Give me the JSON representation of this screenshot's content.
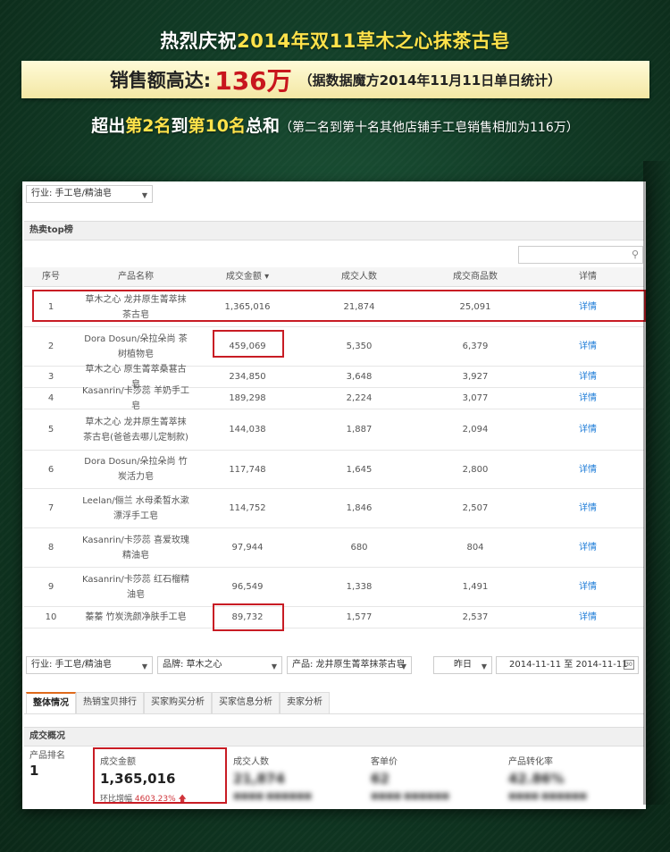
{
  "banner": {
    "line1_a": "热烈庆祝",
    "line1_b": "2014年双11草木之心",
    "line1_c": "抹茶古皂",
    "sales_label": "销售额高达:",
    "sales_amount": "136万",
    "sales_note": "（据数据魔方2014年11月11日单日统计）",
    "line3_a": "超出",
    "line3_b": "第2名",
    "line3_c": "到",
    "line3_d": "第10名",
    "line3_e": "总和",
    "line3_note": "（第二名到第十名其他店铺手工皂销售相加为116万）"
  },
  "filters_top": {
    "industry": "行业: 手工皂/精油皂"
  },
  "hot_section": {
    "title": "热卖top榜"
  },
  "table": {
    "headers": [
      "序号",
      "产品名称",
      "成交金额",
      "成交人数",
      "成交商品数",
      "详情"
    ],
    "rows": [
      {
        "rank": "1",
        "name": "草木之心 龙井原生菁萃抹茶古皂",
        "amount": "1,365,016",
        "buyers": "21,874",
        "items": "25,091",
        "detail": "详情"
      },
      {
        "rank": "2",
        "name": "Dora Dosun/朵拉朵尚 茶树植物皂",
        "amount": "459,069",
        "buyers": "5,350",
        "items": "6,379",
        "detail": "详情"
      },
      {
        "rank": "3",
        "name": "草木之心 原生菁萃桑葚古皂",
        "amount": "234,850",
        "buyers": "3,648",
        "items": "3,927",
        "detail": "详情"
      },
      {
        "rank": "4",
        "name": "Kasanrin/卡莎蕊 羊奶手工皂",
        "amount": "189,298",
        "buyers": "2,224",
        "items": "3,077",
        "detail": "详情"
      },
      {
        "rank": "5",
        "name": "草木之心 龙井原生菁萃抹茶古皂(爸爸去哪儿定制款)",
        "amount": "144,038",
        "buyers": "1,887",
        "items": "2,094",
        "detail": "详情"
      },
      {
        "rank": "6",
        "name": "Dora Dosun/朵拉朵尚 竹炭活力皂",
        "amount": "117,748",
        "buyers": "1,645",
        "items": "2,800",
        "detail": "详情"
      },
      {
        "rank": "7",
        "name": "Leelan/俪兰 水母柔皙水漱漂浮手工皂",
        "amount": "114,752",
        "buyers": "1,846",
        "items": "2,507",
        "detail": "详情"
      },
      {
        "rank": "8",
        "name": "Kasanrin/卡莎蕊 喜爱玫瑰精油皂",
        "amount": "97,944",
        "buyers": "680",
        "items": "804",
        "detail": "详情"
      },
      {
        "rank": "9",
        "name": "Kasanrin/卡莎蕊 红石榴精油皂",
        "amount": "96,549",
        "buyers": "1,338",
        "items": "1,491",
        "detail": "详情"
      },
      {
        "rank": "10",
        "name": "蓁蓁 竹炭洗颜净肤手工皂",
        "amount": "89,732",
        "buyers": "1,577",
        "items": "2,537",
        "detail": "详情"
      }
    ]
  },
  "filters_bottom": {
    "industry": "行业: 手工皂/精油皂",
    "brand": "品牌: 草木之心",
    "product": "产品: 龙井原生菁萃抹茶古皂",
    "period": "昨日",
    "date_range": "2014-11-11 至 2014-11-11"
  },
  "tabs": [
    "整体情况",
    "热销宝贝排行",
    "买家购买分析",
    "买家信息分析",
    "卖家分析"
  ],
  "overview": {
    "title": "成交概况",
    "rank_label": "产品排名",
    "rank_value": "1",
    "amount_label": "成交金额",
    "amount_value": "1,365,016",
    "amount_growth_label": "环比增幅",
    "amount_growth_value": "4603.23%",
    "buyers_label": "成交人数",
    "buyers_value": "21,874",
    "price_label": "客单价",
    "price_value": "62",
    "conv_label": "产品转化率",
    "conv_value": "42.86%"
  },
  "colors": {
    "accent_red": "#c81c24",
    "link_blue": "#1a7ad7",
    "highlight_yellow": "#ffe24a",
    "bg_green": "#123d27"
  }
}
